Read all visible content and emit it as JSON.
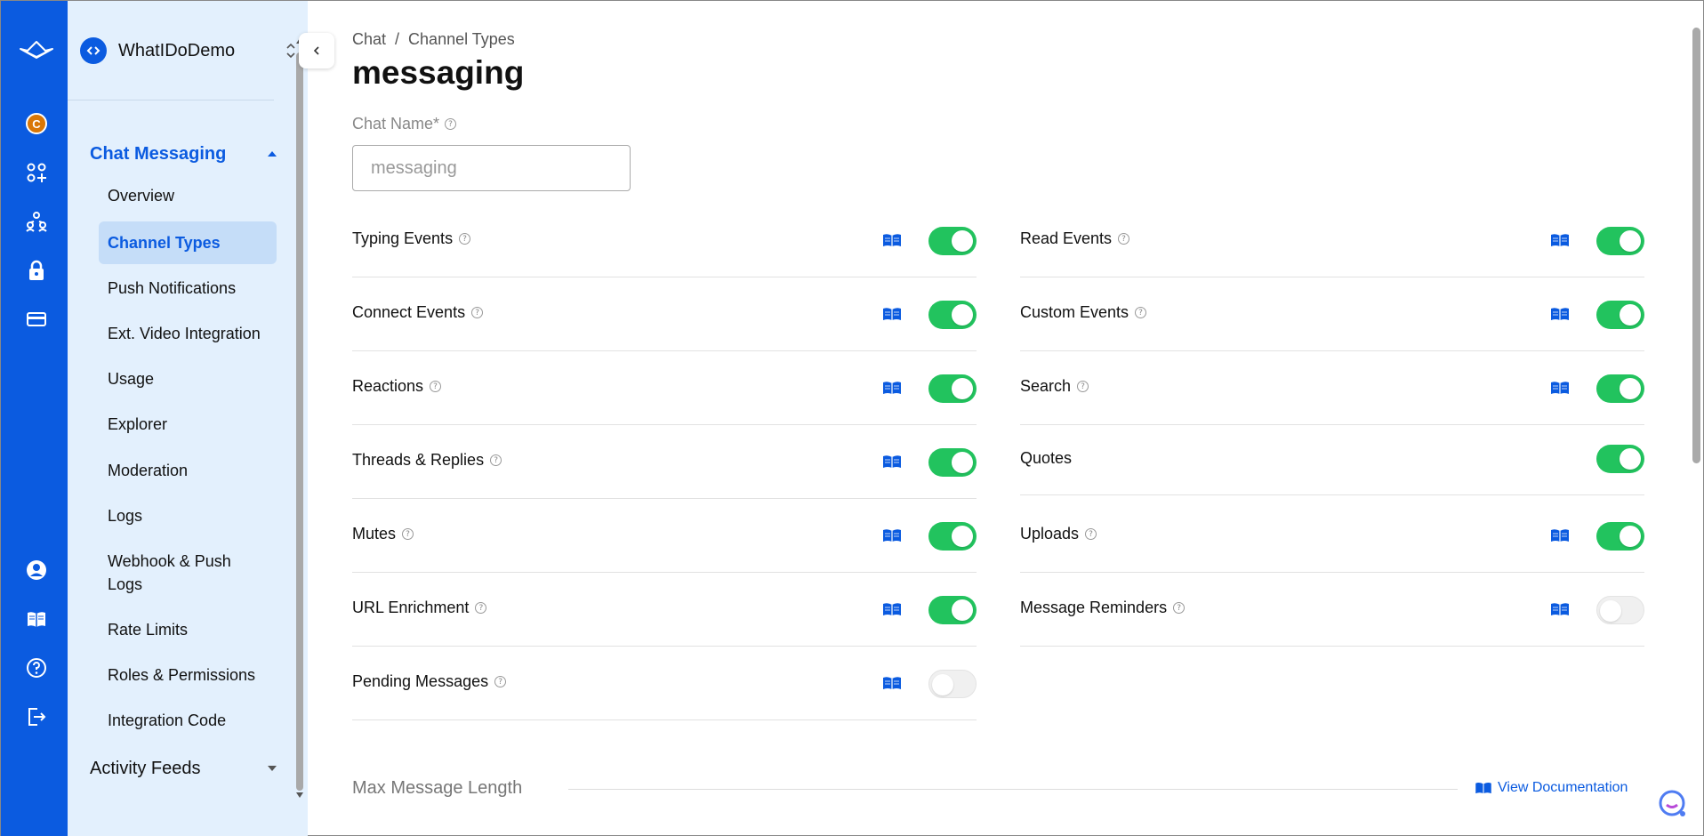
{
  "org": {
    "name": "WhatIDoDemo"
  },
  "rail": {
    "avatar_initial": "C"
  },
  "sidebar": {
    "sections": [
      {
        "label": "Chat Messaging"
      },
      {
        "label": "Activity Feeds"
      }
    ],
    "items": [
      {
        "label": "Overview"
      },
      {
        "label": "Channel Types"
      },
      {
        "label": "Push Notifications"
      },
      {
        "label": "Ext. Video Integration"
      },
      {
        "label": "Usage"
      },
      {
        "label": "Explorer"
      },
      {
        "label": "Moderation"
      },
      {
        "label": "Logs"
      },
      {
        "label": "Webhook & Push Logs"
      },
      {
        "label": "Rate Limits"
      },
      {
        "label": "Roles & Permissions"
      },
      {
        "label": "Integration Code"
      }
    ],
    "selected": "Channel Types"
  },
  "breadcrumb": {
    "root": "Chat",
    "separator": "/",
    "current": "Channel Types"
  },
  "page_title": "messaging",
  "chat_name": {
    "label": "Chat Name*",
    "placeholder": "messaging"
  },
  "settings": {
    "left": [
      {
        "label": "Typing Events",
        "enabled": true,
        "has_help": true,
        "has_doc": true
      },
      {
        "label": "Connect Events",
        "enabled": true,
        "has_help": true,
        "has_doc": true
      },
      {
        "label": "Reactions",
        "enabled": true,
        "has_help": true,
        "has_doc": true
      },
      {
        "label": "Threads & Replies",
        "enabled": true,
        "has_help": true,
        "has_doc": true
      },
      {
        "label": "Mutes",
        "enabled": true,
        "has_help": true,
        "has_doc": true
      },
      {
        "label": "URL Enrichment",
        "enabled": true,
        "has_help": true,
        "has_doc": true
      },
      {
        "label": "Pending Messages",
        "enabled": false,
        "has_help": true,
        "has_doc": true
      }
    ],
    "right": [
      {
        "label": "Read Events",
        "enabled": true,
        "has_help": true,
        "has_doc": true
      },
      {
        "label": "Custom Events",
        "enabled": true,
        "has_help": true,
        "has_doc": true
      },
      {
        "label": "Search",
        "enabled": true,
        "has_help": true,
        "has_doc": true
      },
      {
        "label": "Quotes",
        "enabled": true,
        "has_help": false,
        "has_doc": false
      },
      {
        "label": "Uploads",
        "enabled": true,
        "has_help": true,
        "has_doc": true
      },
      {
        "label": "Message Reminders",
        "enabled": false,
        "has_help": true,
        "has_doc": true
      }
    ]
  },
  "max_message_length": {
    "label": "Max Message Length",
    "doc_link": "View Documentation"
  },
  "colors": {
    "brand": "#0b5be0",
    "sidebar_bg": "#e3f0fd",
    "toggle_on": "#22c35e",
    "toggle_off": "#f0f0f0"
  }
}
